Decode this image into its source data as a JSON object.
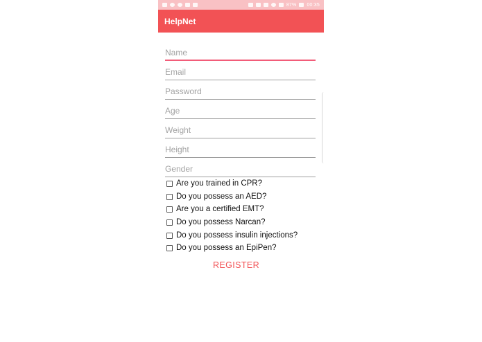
{
  "status_bar": {
    "time": "00:35",
    "battery": "87%"
  },
  "app_bar": {
    "title": "HelpNet"
  },
  "form": {
    "name_placeholder": "Name",
    "email_placeholder": "Email",
    "password_placeholder": "Password",
    "age_placeholder": "Age",
    "weight_placeholder": "Weight",
    "height_placeholder": "Height",
    "gender_placeholder": "Gender"
  },
  "checkboxes": [
    {
      "label": "Are you trained in CPR?",
      "checked": false
    },
    {
      "label": "Do you possess an AED?",
      "checked": false
    },
    {
      "label": "Are you a certified EMT?",
      "checked": false
    },
    {
      "label": "Do you possess Narcan?",
      "checked": false
    },
    {
      "label": "Do you possess insulin injections?",
      "checked": false
    },
    {
      "label": "Do you possess an EpiPen?",
      "checked": false
    }
  ],
  "register_label": "REGISTER",
  "colors": {
    "primary": "#f25255",
    "status_bar": "#f9c1c4",
    "focus_underline": "#f25c79"
  }
}
